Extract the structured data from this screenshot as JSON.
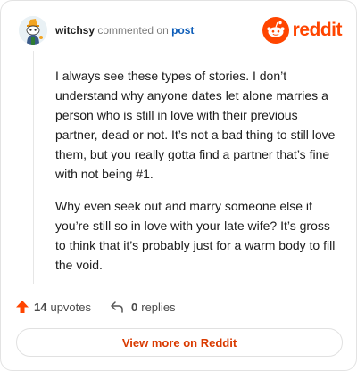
{
  "comment": {
    "username": "witchsy",
    "action_text": "commented on",
    "post_link": "post",
    "paragraphs": [
      "I always see these types of stories. I don’t understand why anyone dates let alone marries a person who is still in love with their previous partner, dead or not. It’s not a bad thing to still love them, but you really gotta find a partner that’s fine with not being #1.",
      "Why even seek out and marry someone else if you’re still so in love with your late wife? It’s gross to think that it’s probably just for a warm body to fill the void."
    ]
  },
  "brand": {
    "wordmark": "reddit",
    "color": "#ff4500"
  },
  "stats": {
    "upvotes_count": "14",
    "upvotes_label": "upvotes",
    "replies_count": "0",
    "replies_label": "replies",
    "upvote_color": "#ff4500"
  },
  "footer": {
    "view_more_label": "View more on Reddit"
  },
  "icons": {
    "avatar": "snoo-avatar-icon",
    "logo": "reddit-logo-icon",
    "upvote": "upvote-arrow-icon",
    "reply": "reply-arrow-icon"
  }
}
